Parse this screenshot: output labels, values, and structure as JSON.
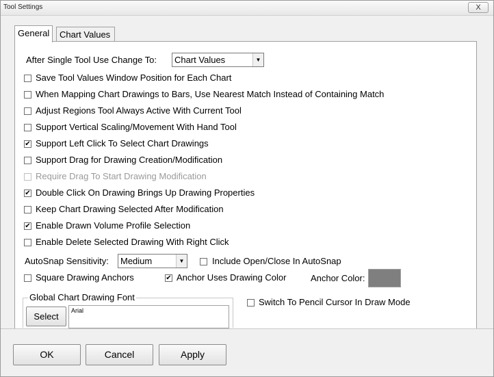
{
  "window": {
    "title": "Tool Settings",
    "close_glyph": "X"
  },
  "tabs": [
    {
      "label": "General",
      "active": true
    },
    {
      "label": "Chart Values",
      "active": false
    }
  ],
  "after_single_tool": {
    "label": "After Single Tool Use Change To:",
    "value": "Chart Values"
  },
  "checkboxes": [
    {
      "label": "Save Tool Values Window Position for Each Chart",
      "checked": false,
      "enabled": true
    },
    {
      "label": "When Mapping Chart Drawings to Bars, Use Nearest Match Instead of Containing Match",
      "checked": false,
      "enabled": true
    },
    {
      "label": "Adjust Regions Tool Always Active With Current Tool",
      "checked": false,
      "enabled": true
    },
    {
      "label": "Support Vertical Scaling/Movement With Hand Tool",
      "checked": false,
      "enabled": true
    },
    {
      "label": "Support Left Click To Select Chart Drawings",
      "checked": true,
      "enabled": true
    },
    {
      "label": "Support Drag for Drawing Creation/Modification",
      "checked": false,
      "enabled": true
    },
    {
      "label": "Require Drag To Start Drawing Modification",
      "checked": false,
      "enabled": false
    },
    {
      "label": "Double Click On Drawing Brings Up Drawing Properties",
      "checked": true,
      "enabled": true
    },
    {
      "label": "Keep Chart Drawing Selected After Modification",
      "checked": false,
      "enabled": true
    },
    {
      "label": "Enable Drawn Volume Profile Selection",
      "checked": true,
      "enabled": true
    },
    {
      "label": "Enable Delete Selected Drawing With Right Click",
      "checked": false,
      "enabled": true
    }
  ],
  "autosnap": {
    "label": "AutoSnap Sensitivity:",
    "value": "Medium"
  },
  "include_open_close": {
    "label": "Include Open/Close In AutoSnap",
    "checked": false
  },
  "square_anchors": {
    "label": "Square Drawing Anchors",
    "checked": false
  },
  "anchor_uses_color": {
    "label": "Anchor Uses Drawing Color",
    "checked": true
  },
  "anchor_color": {
    "label": "Anchor Color:",
    "color": "#7f7f7f"
  },
  "font_group": {
    "label": "Global Chart Drawing Font",
    "select_label": "Select",
    "font_name": "Arial"
  },
  "pencil_cursor": {
    "label": "Switch To Pencil Cursor In Draw Mode",
    "checked": false
  },
  "buttons": {
    "ok": "OK",
    "cancel": "Cancel",
    "apply": "Apply"
  },
  "glyphs": {
    "check": "✔",
    "dropdown_arrow": "▼"
  }
}
